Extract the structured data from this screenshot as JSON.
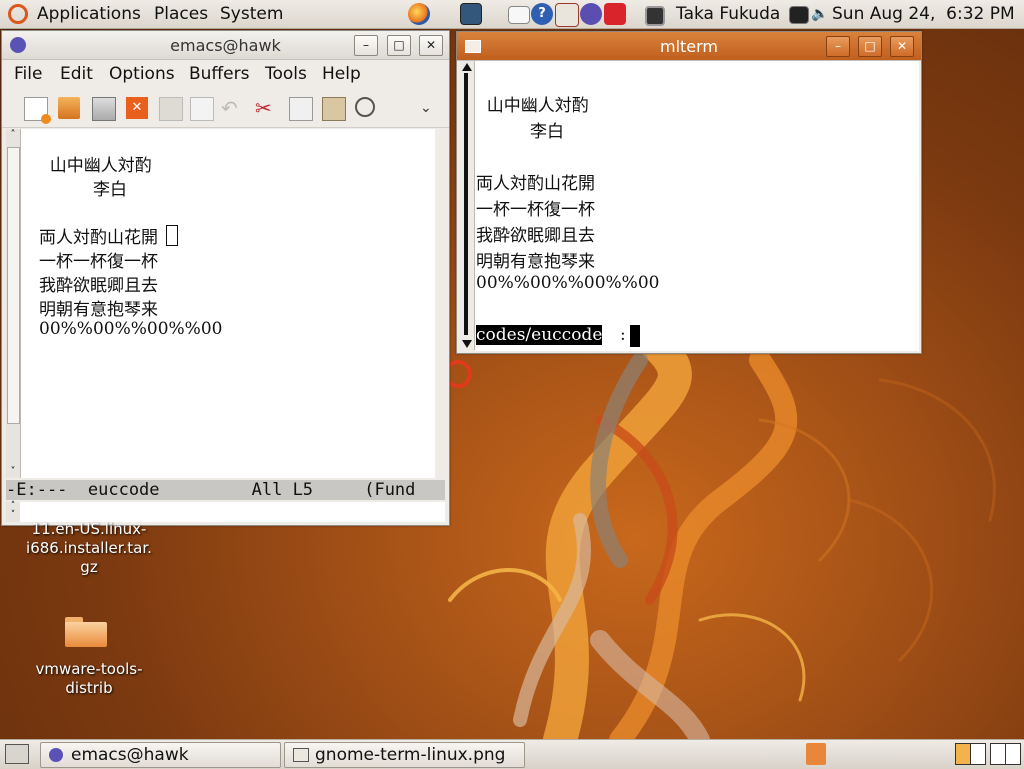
{
  "top_panel": {
    "menus": [
      "Applications",
      "Places",
      "System"
    ],
    "user": "Taka Fukuda",
    "clock": "Sun Aug 24,  6:32 PM"
  },
  "emacs": {
    "title": "emacs@hawk",
    "menus": [
      "File",
      "Edit",
      "Options",
      "Buffers",
      "Tools",
      "Help"
    ],
    "lines": [
      "  山中幽人対酌",
      "          李白",
      "",
      "両人対酌山花開",
      "一杯一杯復一杯",
      "我酔欲眠卿且去",
      "明朝有意抱琴来",
      "00%%00%%00%%00"
    ],
    "modeline": "-E:---  euccode         All L5     (Fund"
  },
  "mlterm": {
    "title": "mlterm",
    "lines": [
      "  山中幽人対酌",
      "          李白",
      "",
      "両人対酌山花開",
      "一杯一杯復一杯",
      "我酔欲眠卿且去",
      "明朝有意抱琴来",
      "00%%00%%00%%00"
    ],
    "prompt": "codes/euccode"
  },
  "desktop": {
    "icon1_label": "11.en-US.linux-\ni686.installer.tar.\ngz",
    "icon2_label": "vmware-tools-\ndistrib"
  },
  "taskbar": {
    "tasks": [
      "emacs@hawk",
      "gnome-term-linux.png"
    ]
  },
  "colors": {
    "titlebar_active": "#c8682a",
    "desktop_bg": "#a65217"
  }
}
